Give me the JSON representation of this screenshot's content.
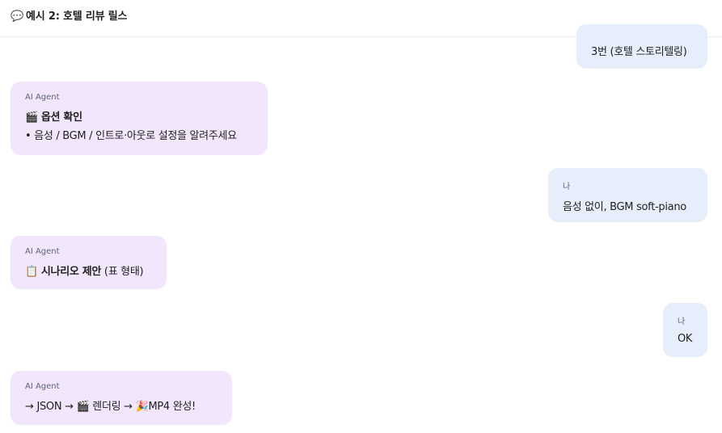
{
  "header": {
    "icon": "speech-bubble-icon",
    "icon_glyph": "💬",
    "title": "예시 2: 호텔 리뷰 릴스"
  },
  "messages": [
    {
      "role": "user",
      "speaker": "",
      "text": "3번 (호텔 스토리텔링)"
    },
    {
      "role": "agent",
      "speaker": "AI Agent",
      "title_icon": "clapper-board-icon",
      "title_glyph": "🎬",
      "title": "옵션 확인",
      "body": "• 음성 / BGM / 인트로·아웃로 설정을 알려주세요"
    },
    {
      "role": "user",
      "speaker": "나",
      "text": "음성 없이, BGM soft-piano"
    },
    {
      "role": "agent",
      "speaker": "AI Agent",
      "title_icon": "clipboard-icon",
      "title_glyph": "📋",
      "title": "시나리오 제안",
      "title_suffix": "(표 형태)"
    },
    {
      "role": "user",
      "speaker": "나",
      "text": "OK"
    },
    {
      "role": "agent",
      "speaker": "AI Agent",
      "pipeline": {
        "arrow": "→",
        "step1": "JSON",
        "step2_icon": "clapper-board-icon",
        "step2_glyph": "🎬",
        "step2": "렌더링",
        "step3_icon": "party-popper-icon",
        "step3_glyph": "🎉",
        "step3": "MP4 완성!"
      }
    }
  ]
}
